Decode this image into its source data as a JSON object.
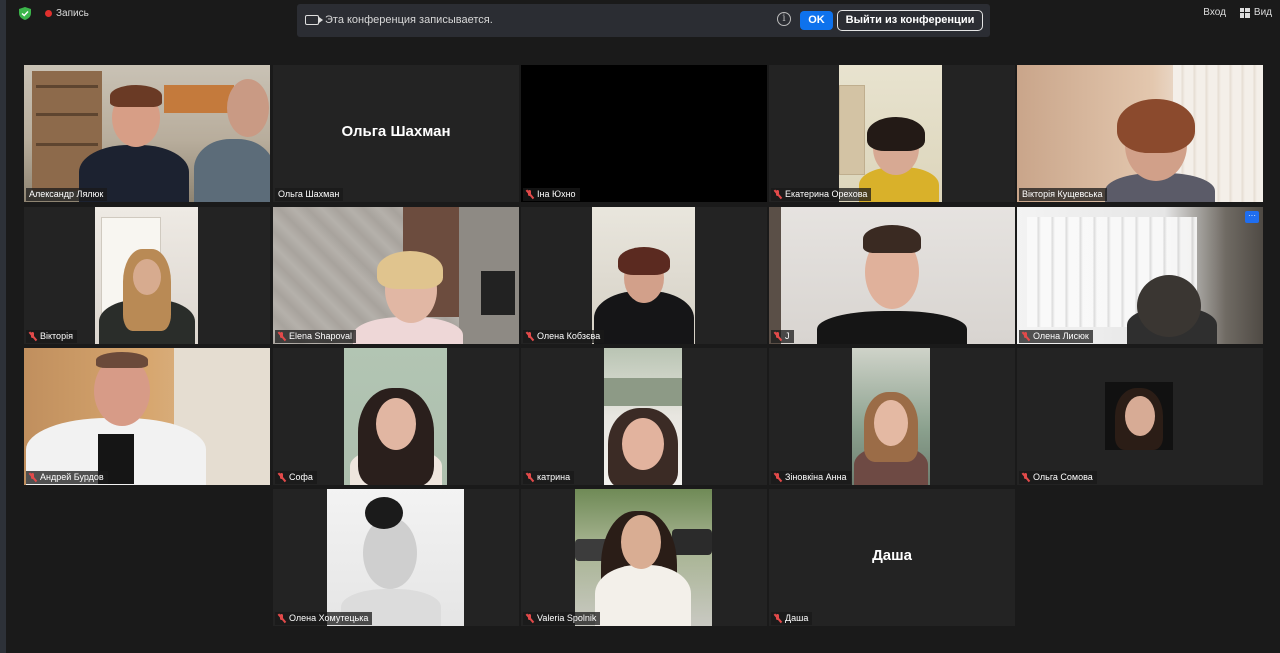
{
  "topbar": {
    "recording_label": "Запись",
    "enter_label": "Вход",
    "view_label": "Вид"
  },
  "banner": {
    "text": "Эта конференция записывается.",
    "ok_label": "OK",
    "leave_label": "Выйти из конференции"
  },
  "participants": [
    {
      "name": "Александр Лялюк",
      "muted": false,
      "active": true
    },
    {
      "name": "Ольга Шахман",
      "muted": false,
      "center_label": "Ольга Шахман"
    },
    {
      "name": "Іна Юхно",
      "muted": true
    },
    {
      "name": "Екатерина Орехова",
      "muted": true
    },
    {
      "name": "Вікторія Кущевська",
      "muted": false
    },
    {
      "name": "Вікторія",
      "muted": true
    },
    {
      "name": "Elena Shapoval",
      "muted": true
    },
    {
      "name": "Олена Кобзєва",
      "muted": true
    },
    {
      "name": "J",
      "muted": true
    },
    {
      "name": "Олена Лисюк",
      "muted": true,
      "more_label": "···"
    },
    {
      "name": "Андрей Бурдов",
      "muted": true
    },
    {
      "name": "Софа",
      "muted": true
    },
    {
      "name": "катрина",
      "muted": true
    },
    {
      "name": "Зіновкіна Анна",
      "muted": true
    },
    {
      "name": "Ольга Сомова",
      "muted": true
    },
    {
      "name": "Олена Хомутецька",
      "muted": true
    },
    {
      "name": "Valeria Spolnik",
      "muted": true
    },
    {
      "name": "Даша",
      "muted": true,
      "center_label": "Даша"
    }
  ],
  "colors": {
    "accent": "#0e72ed",
    "active_speaker_border": "#d1f06a",
    "muted_icon": "#e24a4a",
    "record_dot": "#e0302d"
  }
}
